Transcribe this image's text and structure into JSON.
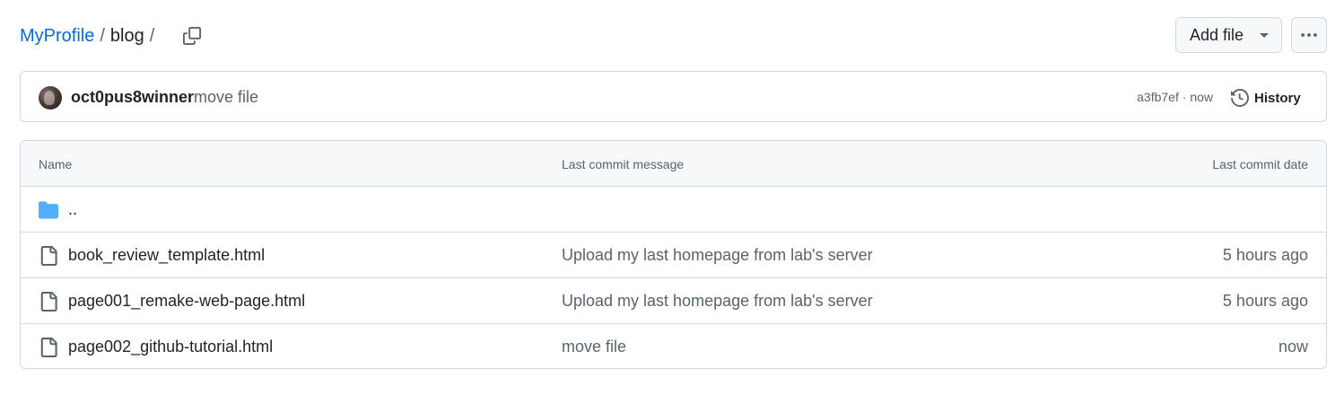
{
  "breadcrumb": {
    "repo": "MyProfile",
    "separator": "/",
    "current": "blog",
    "trailing_separator": "/"
  },
  "toolbar": {
    "add_file_label": "Add file",
    "copy_icon": "copy-icon",
    "more_icon": "kebab-horizontal-icon"
  },
  "commit": {
    "author": "oct0pus8winner",
    "message": "move file",
    "hash": "a3fb7ef",
    "dot": "·",
    "time": "now",
    "history_label": "History",
    "history_icon": "history-icon"
  },
  "table": {
    "headers": {
      "name": "Name",
      "message": "Last commit message",
      "date": "Last commit date"
    },
    "parent_row": {
      "name": "..",
      "icon": "folder-icon"
    },
    "rows": [
      {
        "name": "book_review_template.html",
        "message": "Upload my last homepage from lab's server",
        "date": "5 hours ago",
        "icon": "file-icon"
      },
      {
        "name": "page001_remake-web-page.html",
        "message": "Upload my last homepage from lab's server",
        "date": "5 hours ago",
        "icon": "file-icon"
      },
      {
        "name": "page002_github-tutorial.html",
        "message": "move file",
        "date": "now",
        "icon": "file-icon"
      }
    ]
  },
  "colors": {
    "link": "#0969da",
    "text": "#1f2328",
    "muted": "#59636e",
    "border": "#d1d9e0",
    "header_bg": "#f6f8fa",
    "folder": "#54aeff"
  }
}
